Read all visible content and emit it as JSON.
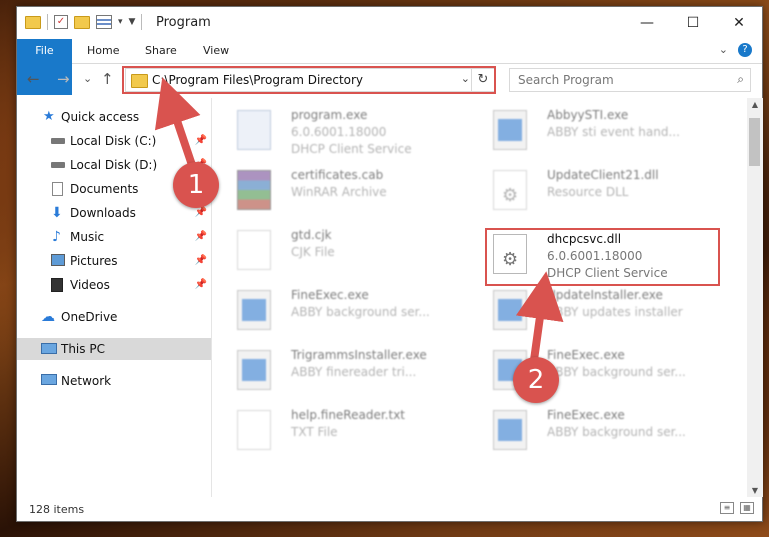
{
  "window": {
    "title": "Program"
  },
  "titlebar_controls": {
    "minimize": "—",
    "maximize": "☐",
    "close": "✕"
  },
  "ribbon": {
    "tabs": [
      "File",
      "Home",
      "Share",
      "View"
    ],
    "help": "?",
    "expand": "⌄"
  },
  "navigation": {
    "back": "←",
    "forward": "→",
    "recent": "⌄",
    "up": "↑"
  },
  "address": {
    "path": "C:\\Program Files\\Program Directory",
    "dropdown": "⌄",
    "refresh": "↻"
  },
  "search": {
    "placeholder": "Search Program",
    "icon": "⌕"
  },
  "sidebar": {
    "items": [
      {
        "label": "Quick access",
        "icon": "star-icon",
        "pinned": false
      },
      {
        "label": "Local Disk (C:)",
        "icon": "drive-icon",
        "pinned": true
      },
      {
        "label": "Local Disk (D:)",
        "icon": "drive-icon",
        "pinned": true
      },
      {
        "label": "Documents",
        "icon": "documents-icon",
        "pinned": true
      },
      {
        "label": "Downloads",
        "icon": "download-icon",
        "pinned": true
      },
      {
        "label": "Music",
        "icon": "music-icon",
        "pinned": true
      },
      {
        "label": "Pictures",
        "icon": "pictures-icon",
        "pinned": true
      },
      {
        "label": "Videos",
        "icon": "videos-icon",
        "pinned": true
      },
      {
        "label": "OneDrive",
        "icon": "cloud-icon",
        "pinned": false
      },
      {
        "label": "This PC",
        "icon": "computer-icon",
        "pinned": false,
        "selected": true
      },
      {
        "label": "Network",
        "icon": "network-icon",
        "pinned": false
      }
    ]
  },
  "files": {
    "left": [
      {
        "name": "program.exe",
        "line2": "6.0.6001.18000",
        "line3": "DHCP Client Service",
        "icon": "exe-icon"
      },
      {
        "name": "certificates.cab",
        "line2": "WinRAR Archive",
        "line3": "",
        "icon": "rar-icon"
      },
      {
        "name": "gtd.cjk",
        "line2": "CJK File",
        "line3": "",
        "icon": "document-icon"
      },
      {
        "name": "FineExec.exe",
        "line2": "ABBY background ser...",
        "line3": "",
        "icon": "window-icon"
      },
      {
        "name": "TrigrammsInstaller.exe",
        "line2": "ABBY finereader tri...",
        "line3": "",
        "icon": "window-icon"
      },
      {
        "name": "help.fineReader.txt",
        "line2": "TXT File",
        "line3": "",
        "icon": "document-icon"
      }
    ],
    "right": [
      {
        "name": "AbbyySTI.exe",
        "line2": "ABBY sti event hand...",
        "line3": "",
        "icon": "window-icon"
      },
      {
        "name": "UpdateClient21.dll",
        "line2": "Resource DLL",
        "line3": "",
        "icon": "gear-file-icon"
      },
      {
        "name": "dhcpcsvc.dll",
        "line2": "6.0.6001.18000",
        "line3": "DHCP Client Service",
        "icon": "gear-file-icon",
        "highlighted": true
      },
      {
        "name": "UpdateInstaller.exe",
        "line2": "ABBY updates installer",
        "line3": "",
        "icon": "window-icon"
      },
      {
        "name": "FineExec.exe",
        "line2": "ABBY background ser...",
        "line3": "",
        "icon": "window-icon"
      },
      {
        "name": "FineExec.exe",
        "line2": "ABBY background ser...",
        "line3": "",
        "icon": "window-icon"
      }
    ]
  },
  "scrollbar": {
    "up": "▲",
    "down": "▼"
  },
  "status": {
    "count": "128 items"
  },
  "callouts": {
    "one": "1",
    "two": "2"
  },
  "colors": {
    "accent": "#1979ca",
    "highlight": "#d9534f",
    "selected": "#d9d9d9"
  }
}
